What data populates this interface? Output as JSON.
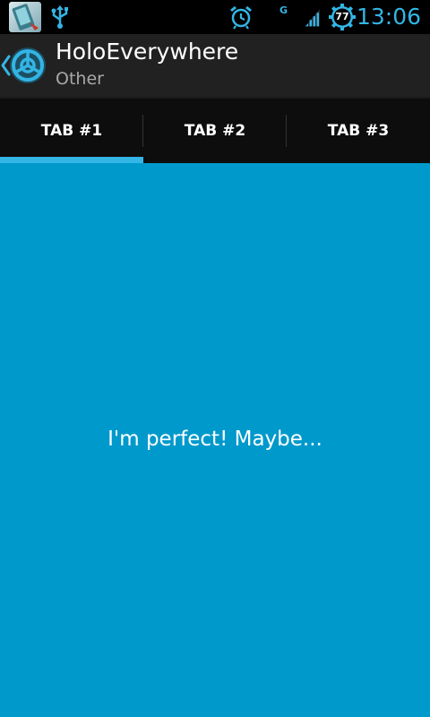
{
  "status_bar": {
    "time": "13:06",
    "battery_level": "77",
    "network_type": "G",
    "icons": [
      "app-notification-icon",
      "usb-icon",
      "alarm-icon",
      "signal-icon",
      "battery-icon"
    ]
  },
  "action_bar": {
    "title": "HoloEverywhere",
    "subtitle": "Other",
    "icon": "holo-app-logo-icon"
  },
  "tabs": [
    {
      "label": "TAB #1",
      "selected": true
    },
    {
      "label": "TAB #2",
      "selected": false
    },
    {
      "label": "TAB #3",
      "selected": false
    }
  ],
  "content": {
    "text": "I'm perfect! Maybe..."
  },
  "colors": {
    "accent": "#33b5e5",
    "content_background": "#0099cc",
    "action_bar_background": "#212121",
    "tab_bar_background": "#0d0d0d",
    "status_bar_background": "#000000"
  }
}
